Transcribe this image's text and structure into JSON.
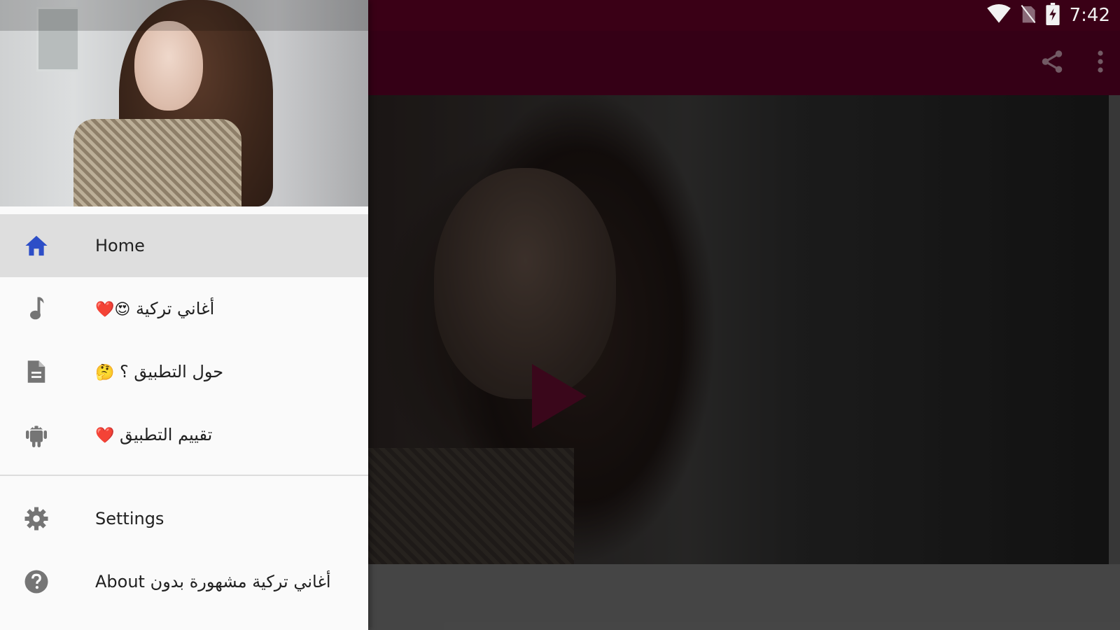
{
  "status_bar": {
    "time": "7:42",
    "icons": [
      "wifi-icon",
      "no-sim-icon",
      "battery-charging-icon"
    ]
  },
  "app_bar": {
    "actions": [
      "share-icon",
      "more-vert-icon"
    ]
  },
  "video": {
    "play_icon": "play-icon"
  },
  "drawer": {
    "primary_items": [
      {
        "icon": "home-icon",
        "label": "Home",
        "active": true
      },
      {
        "icon": "music-note-icon",
        "label": "أغاني تركية",
        "suffix": "❤️😍"
      },
      {
        "icon": "document-icon",
        "label": "حول التطبيق ؟",
        "suffix": "🤔"
      },
      {
        "icon": "android-icon",
        "label": "تقييم التطبيق",
        "suffix": "❤️"
      }
    ],
    "secondary_items": [
      {
        "icon": "settings-icon",
        "label": "Settings"
      },
      {
        "icon": "help-icon",
        "label": "About أغاني تركية مشهورة بدون"
      }
    ]
  },
  "colors": {
    "status_bar": "#3a0016",
    "app_bar": "#520123",
    "home_icon": "#2d4ec7",
    "play_button": "#5a0b2a"
  }
}
